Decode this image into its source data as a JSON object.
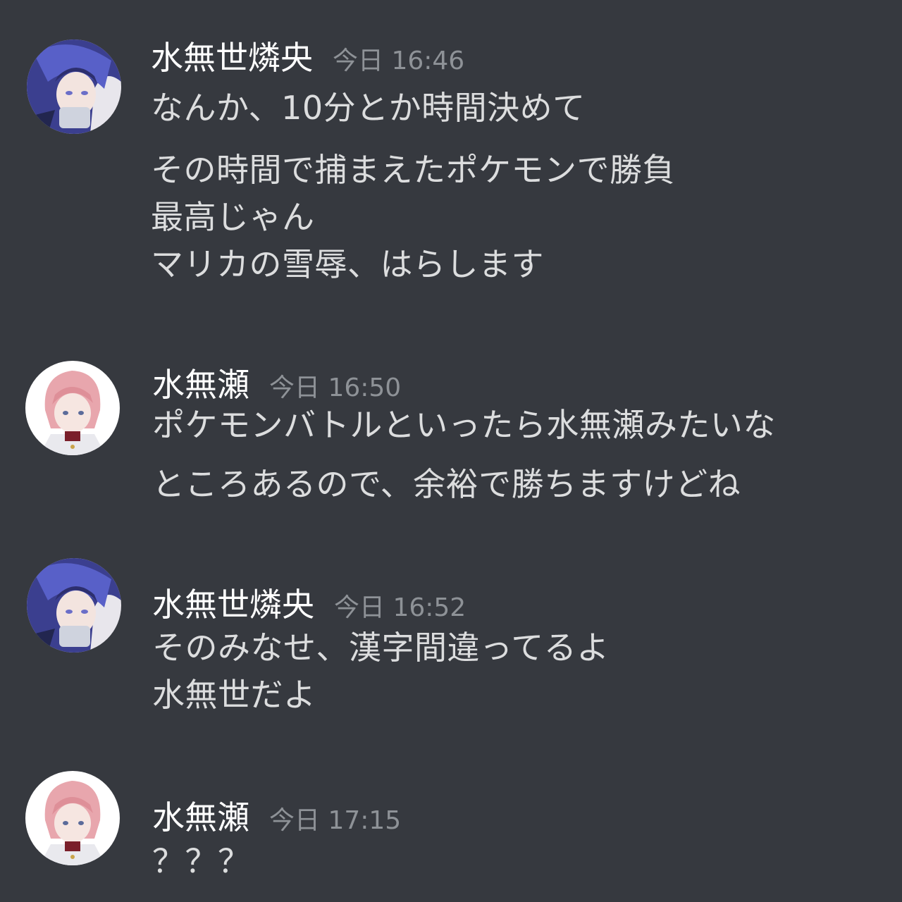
{
  "colors": {
    "background": "#36393f",
    "username": "#ffffff",
    "timestamp": "#8e9297",
    "message_text": "#dcddde"
  },
  "messages": [
    {
      "author": "水無世燐央",
      "time": "今日 16:46",
      "avatar": "blue-haired-character-avatar",
      "lines": [
        "なんか、10分とか時間決めて",
        "その時間で捕まえたポケモンで勝負",
        "最高じゃん",
        "マリカの雪辱、はらします"
      ]
    },
    {
      "author": "水無瀬",
      "time": "今日 16:50",
      "avatar": "pink-haired-character-avatar",
      "lines": [
        "ポケモンバトルといったら水無瀬みたいな",
        "ところあるので、余裕で勝ちますけどね"
      ]
    },
    {
      "author": "水無世燐央",
      "time": "今日 16:52",
      "avatar": "blue-haired-character-avatar",
      "lines": [
        "そのみなせ、漢字間違ってるよ",
        "水無世だよ"
      ]
    },
    {
      "author": "水無瀬",
      "time": "今日 17:15",
      "avatar": "pink-haired-character-avatar",
      "lines": [
        "？？？"
      ]
    }
  ]
}
